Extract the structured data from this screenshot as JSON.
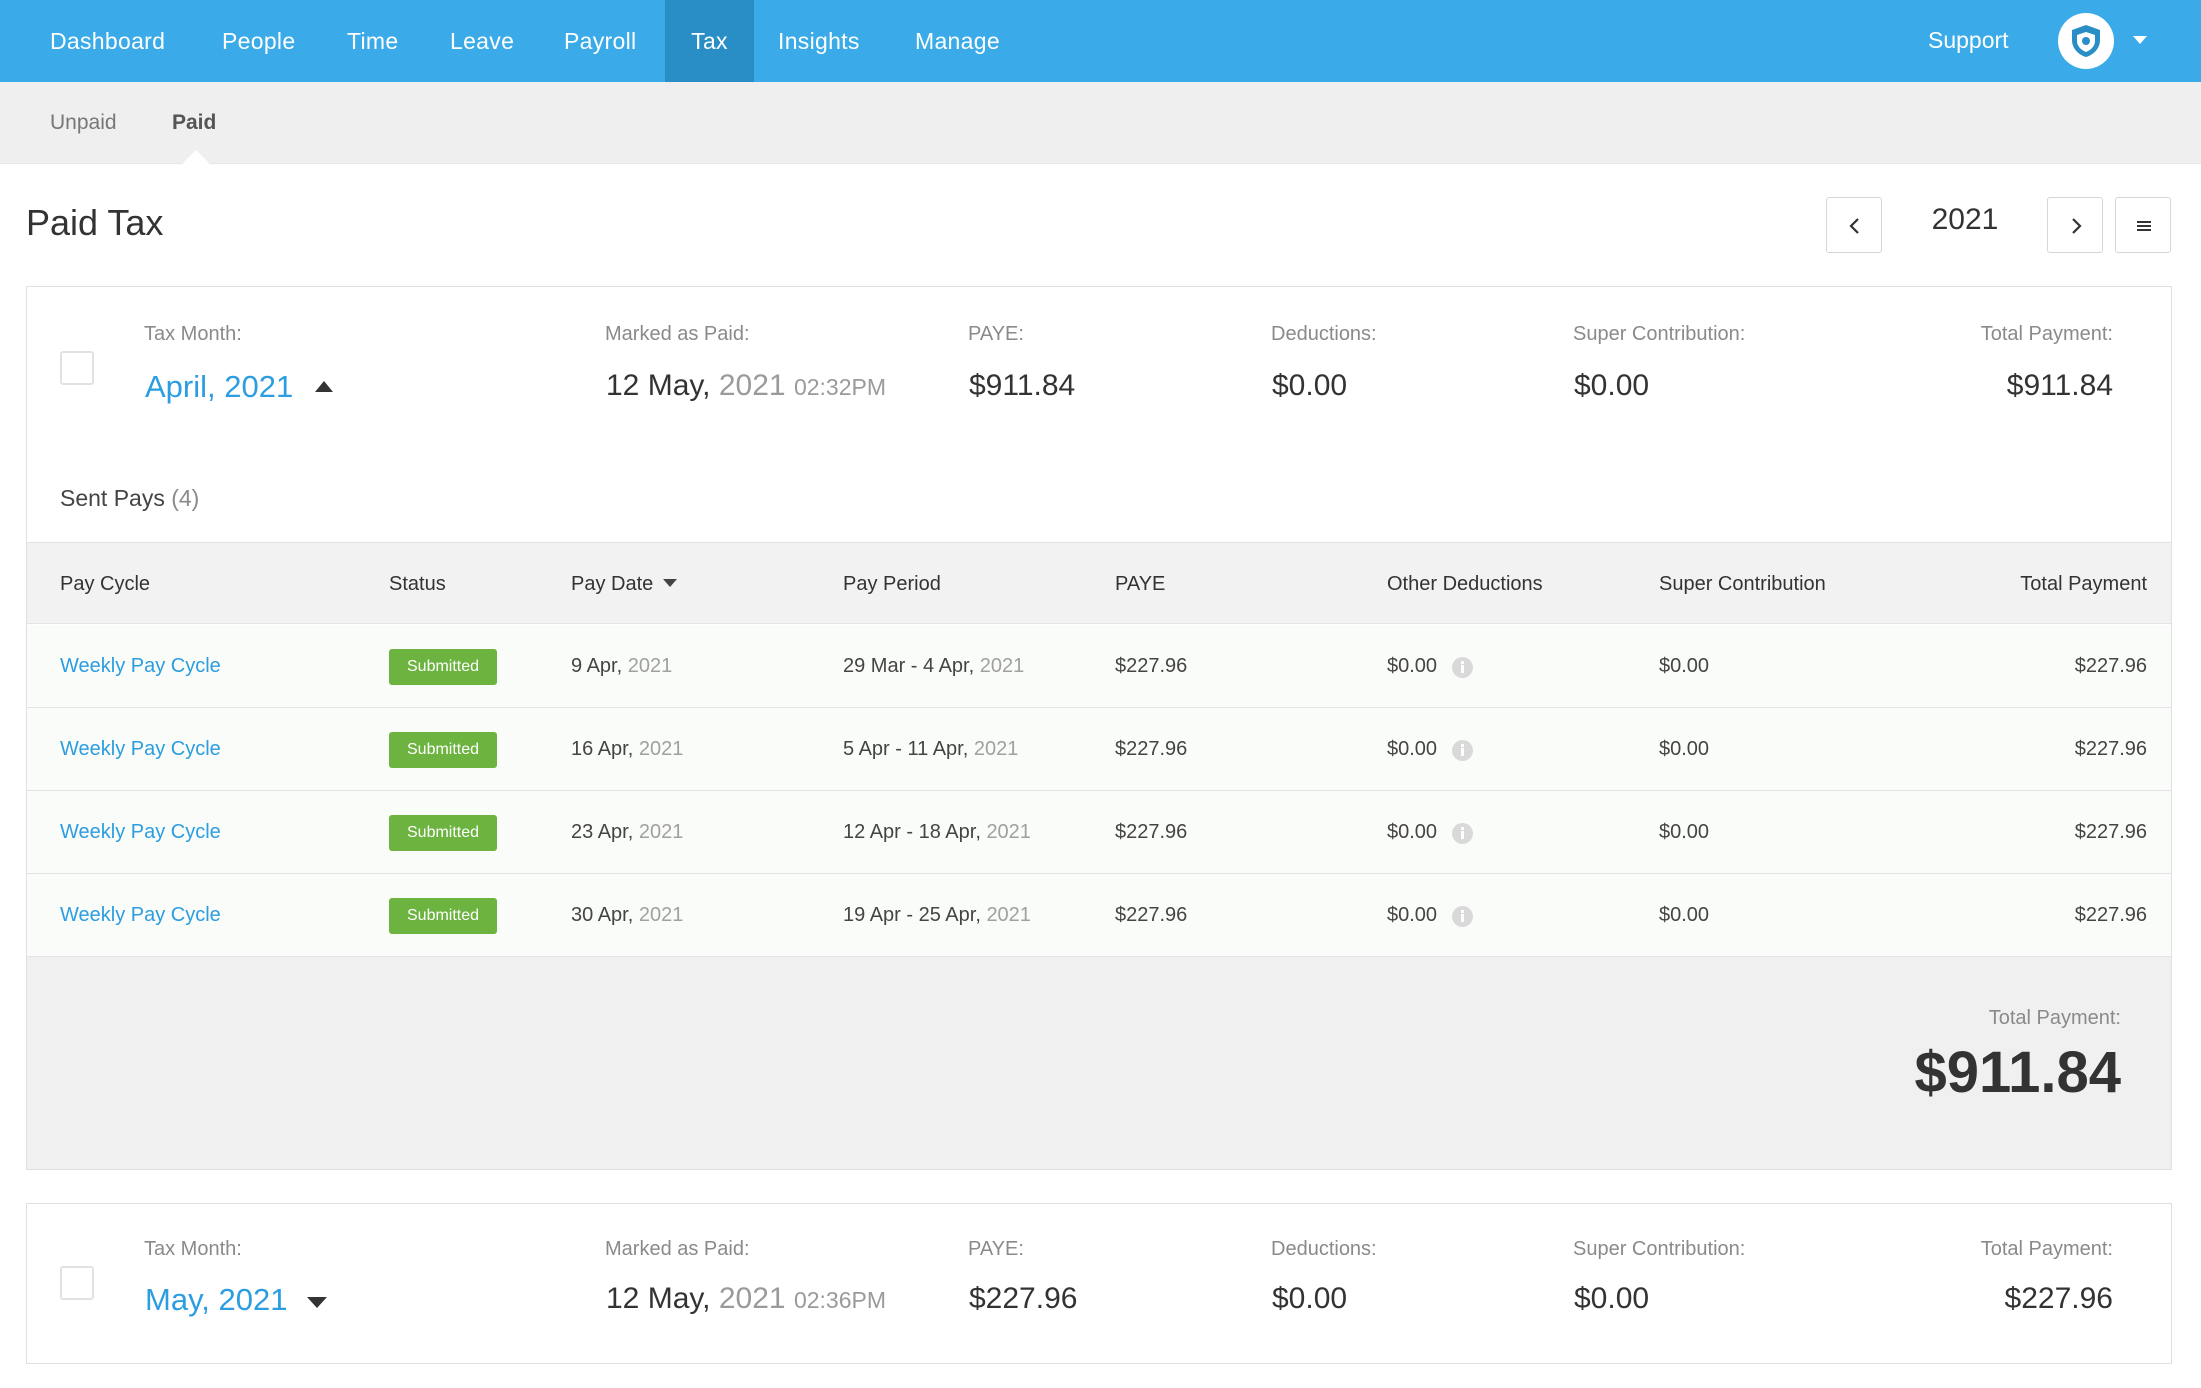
{
  "nav": {
    "items": [
      {
        "label": "Dashboard"
      },
      {
        "label": "People"
      },
      {
        "label": "Time"
      },
      {
        "label": "Leave"
      },
      {
        "label": "Payroll"
      },
      {
        "label": "Tax"
      },
      {
        "label": "Insights"
      },
      {
        "label": "Manage"
      }
    ],
    "active": "Tax",
    "support_label": "Support"
  },
  "subnav": {
    "items": [
      {
        "label": "Unpaid"
      },
      {
        "label": "Paid"
      }
    ],
    "active": "Paid"
  },
  "page": {
    "title": "Paid Tax",
    "year": "2021"
  },
  "colors": {
    "nav_bg": "#3aabe8",
    "nav_active": "#2a8ec6",
    "link": "#2b9de0",
    "badge": "#6cb33f"
  },
  "months": [
    {
      "tax_month_label": "Tax Month:",
      "tax_month": "April, 2021",
      "expanded": true,
      "marked_paid_label": "Marked as Paid:",
      "marked_paid_day": "12 May,",
      "marked_paid_year": "2021",
      "marked_paid_time": "02:32PM",
      "paye_label": "PAYE:",
      "paye": "$911.84",
      "deductions_label": "Deductions:",
      "deductions": "$0.00",
      "super_label": "Super Contribution:",
      "super": "$0.00",
      "total_label": "Total Payment:",
      "total": "$911.84",
      "sent_pays_label": "Sent Pays",
      "sent_pays_count": "(4)",
      "table": {
        "headers": {
          "pay_cycle": "Pay Cycle",
          "status": "Status",
          "pay_date": "Pay Date",
          "pay_period": "Pay Period",
          "paye": "PAYE",
          "other_deductions": "Other Deductions",
          "super": "Super Contribution",
          "total": "Total Payment"
        },
        "rows": [
          {
            "pay_cycle": "Weekly Pay Cycle",
            "status": "Submitted",
            "pay_date": "9 Apr,",
            "pay_date_year": "2021",
            "pay_period": "29 Mar - 4 Apr,",
            "pay_period_year": "2021",
            "paye": "$227.96",
            "other_deductions": "$0.00",
            "super": "$0.00",
            "total": "$227.96"
          },
          {
            "pay_cycle": "Weekly Pay Cycle",
            "status": "Submitted",
            "pay_date": "16 Apr,",
            "pay_date_year": "2021",
            "pay_period": "5 Apr - 11 Apr,",
            "pay_period_year": "2021",
            "paye": "$227.96",
            "other_deductions": "$0.00",
            "super": "$0.00",
            "total": "$227.96"
          },
          {
            "pay_cycle": "Weekly Pay Cycle",
            "status": "Submitted",
            "pay_date": "23 Apr,",
            "pay_date_year": "2021",
            "pay_period": "12 Apr - 18 Apr,",
            "pay_period_year": "2021",
            "paye": "$227.96",
            "other_deductions": "$0.00",
            "super": "$0.00",
            "total": "$227.96"
          },
          {
            "pay_cycle": "Weekly Pay Cycle",
            "status": "Submitted",
            "pay_date": "30 Apr,",
            "pay_date_year": "2021",
            "pay_period": "19 Apr - 25 Apr,",
            "pay_period_year": "2021",
            "paye": "$227.96",
            "other_deductions": "$0.00",
            "super": "$0.00",
            "total": "$227.96"
          }
        ]
      },
      "footer_total_label": "Total Payment:",
      "footer_total": "$911.84"
    },
    {
      "tax_month_label": "Tax Month:",
      "tax_month": "May, 2021",
      "expanded": false,
      "marked_paid_label": "Marked as Paid:",
      "marked_paid_day": "12 May,",
      "marked_paid_year": "2021",
      "marked_paid_time": "02:36PM",
      "paye_label": "PAYE:",
      "paye": "$227.96",
      "deductions_label": "Deductions:",
      "deductions": "$0.00",
      "super_label": "Super Contribution:",
      "super": "$0.00",
      "total_label": "Total Payment:",
      "total": "$227.96"
    }
  ],
  "icons": {
    "prev": "chevron-left-icon",
    "next": "chevron-right-icon",
    "menu": "hamburger-menu-icon",
    "avatar": "shield-avatar-icon",
    "info": "info-icon"
  }
}
